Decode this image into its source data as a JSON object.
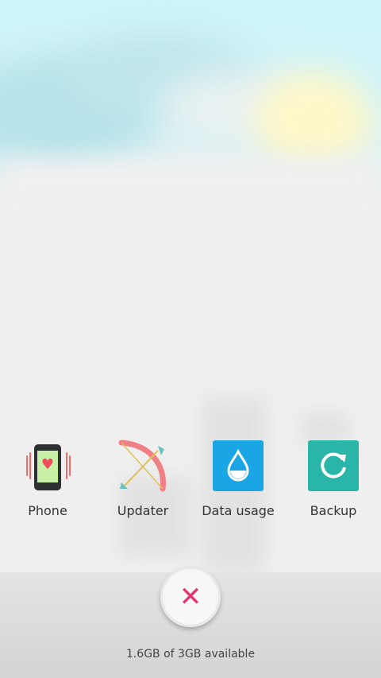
{
  "recent_apps": [
    {
      "label": "Phone",
      "icon": "phone-heart-icon"
    },
    {
      "label": "Updater",
      "icon": "bow-arrow-icon"
    },
    {
      "label": "Data usage",
      "icon": "water-drop-icon"
    },
    {
      "label": "Backup",
      "icon": "refresh-icon"
    }
  ],
  "close_button": {
    "icon": "close-icon",
    "glyph": "✕",
    "color": "#e5336f"
  },
  "memory_status": "1.6GB of 3GB available",
  "colors": {
    "data_usage_tile": "#1aa6e4",
    "backup_tile": "#29b6a8",
    "phone_screen": "#c8f0a6"
  }
}
